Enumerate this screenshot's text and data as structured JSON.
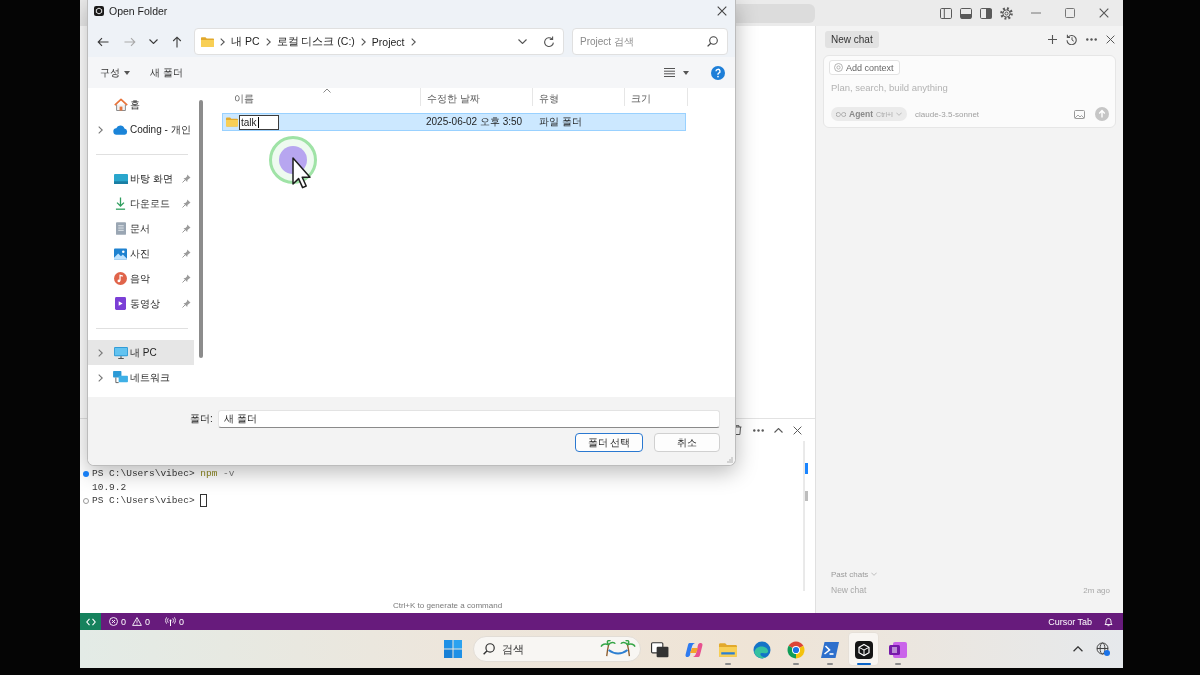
{
  "dialog": {
    "title": "Open Folder",
    "nav_buttons": [
      {
        "disabled": false
      },
      {
        "disabled": true
      },
      {
        "disabled": false
      },
      {
        "disabled": false
      }
    ],
    "breadcrumb": [
      "내 PC",
      "로컬 디스크 (C:)",
      "Project"
    ],
    "search_placeholder": "Project 검색",
    "commands": [
      {
        "label": "구성",
        "has_menu": true
      },
      {
        "label": "새 폴더",
        "has_menu": false
      }
    ],
    "sidebar": {
      "groups": [
        {
          "items": [
            {
              "label": "홈",
              "expandable": false,
              "pinned": false,
              "selected": false
            },
            {
              "label": "Coding - 개인",
              "expandable": true,
              "pinned": false,
              "selected": false
            }
          ]
        },
        {
          "items": [
            {
              "label": "바탕 화면",
              "expandable": false,
              "pinned": true,
              "selected": false
            },
            {
              "label": "다운로드",
              "expandable": false,
              "pinned": true,
              "selected": false
            },
            {
              "label": "문서",
              "expandable": false,
              "pinned": true,
              "selected": false
            },
            {
              "label": "사진",
              "expandable": false,
              "pinned": true,
              "selected": false
            },
            {
              "label": "음악",
              "expandable": false,
              "pinned": true,
              "selected": false
            },
            {
              "label": "동영상",
              "expandable": false,
              "pinned": true,
              "selected": false
            }
          ]
        },
        {
          "items": [
            {
              "label": "내 PC",
              "expandable": true,
              "pinned": false,
              "selected": true
            },
            {
              "label": "네트워크",
              "expandable": true,
              "pinned": false,
              "selected": false
            }
          ]
        }
      ]
    },
    "columns": [
      {
        "label": "이름",
        "sorted": true
      },
      {
        "label": "수정한 날짜",
        "sorted": false
      },
      {
        "label": "유형",
        "sorted": false
      },
      {
        "label": "크기",
        "sorted": false
      }
    ],
    "rows": [
      {
        "name": "talk",
        "modified": "2025-06-02 오후 3:50",
        "type": "파일 폴더",
        "selected": true,
        "renaming": true
      }
    ],
    "folder_field": {
      "label": "폴더:",
      "value": "새 폴더"
    },
    "buttons": [
      {
        "label": "폴더 선택",
        "default": true
      },
      {
        "label": "취소",
        "default": false
      }
    ]
  },
  "terminal": {
    "lines": [
      {
        "kind": "command",
        "succeeded": true,
        "prompt": "PS C:\\Users\\vibec>",
        "command": "npm",
        "args": "-v",
        "cursor": false
      },
      {
        "kind": "output",
        "text": "10.9.2"
      },
      {
        "kind": "command",
        "succeeded": false,
        "prompt": "PS C:\\Users\\vibec>",
        "cursor": true
      }
    ],
    "hint": "Ctrl+K to generate a command"
  },
  "chat_panel": {
    "tabs": [
      {
        "label": "New chat",
        "selected": true
      }
    ],
    "composer": {
      "add_context": "Add context",
      "placeholder": "Plan, search, build anything",
      "mode": "Agent",
      "mode_shortcut": "Ctrl+I",
      "model": "claude-3.5-sonnet"
    },
    "past_chats": {
      "heading": "Past chats",
      "items": [
        {
          "title": "New chat",
          "time": "2m ago"
        }
      ]
    }
  },
  "status_bar": {
    "errors": "0",
    "warnings": "0",
    "ports": "0",
    "right_item": "Cursor Tab"
  },
  "taskbar": {
    "search_placeholder": "검색",
    "apps": [
      {
        "running": false,
        "active": false
      },
      {
        "running": false,
        "active": false
      },
      {
        "running": true,
        "active": false
      },
      {
        "running": false,
        "active": false
      },
      {
        "running": true,
        "active": false
      },
      {
        "running": true,
        "active": false
      },
      {
        "running": true,
        "active": true
      },
      {
        "running": true,
        "active": false
      }
    ]
  }
}
